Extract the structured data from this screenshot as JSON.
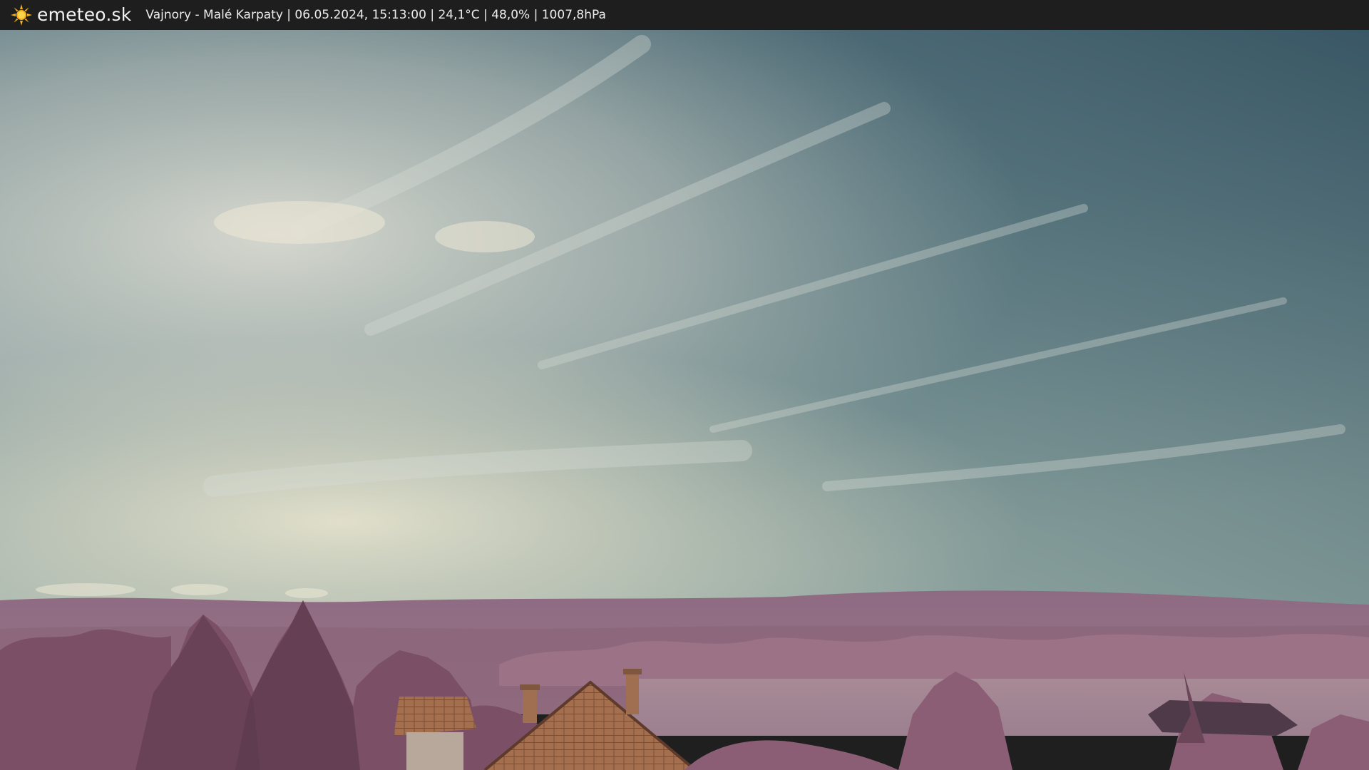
{
  "header": {
    "brand": "emeteo.sk",
    "logo_icon": "sun-icon",
    "caption": "Vajnory - Malé Karpaty | 06.05.2024, 15:13:00 | 24,1°C | 48,0% | 1007,8hPa"
  },
  "colors": {
    "bar_background": "#1e1e1e",
    "sun_yellow": "#f6b21a",
    "sky_top": "#3f5e6e",
    "sky_bottom": "#b8c6b8",
    "hills": "#8e6a80",
    "trees": "#7a4e66",
    "roof": "#a4704e"
  }
}
